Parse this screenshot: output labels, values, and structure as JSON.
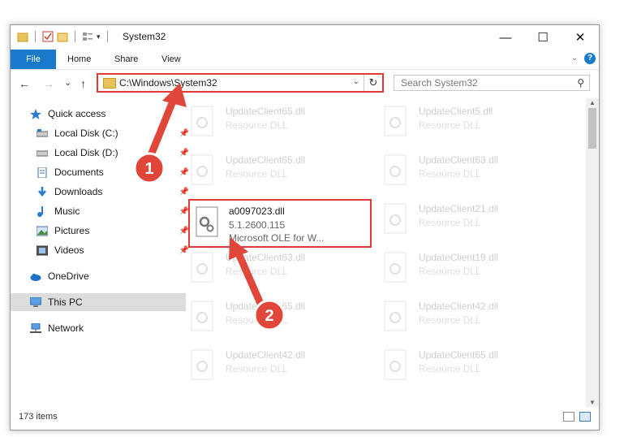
{
  "window": {
    "title": "System32",
    "controls": {
      "minimize": "—",
      "maximize": "☐",
      "close": "✕"
    }
  },
  "ribbon": {
    "tabs": [
      {
        "label": "File"
      },
      {
        "label": "Home"
      },
      {
        "label": "Share"
      },
      {
        "label": "View"
      }
    ]
  },
  "nav": {
    "back": "←",
    "forward": "→",
    "recent": "⌄",
    "up": "↑",
    "address": "C:\\Windows\\System32",
    "search_placeholder": "Search System32"
  },
  "sidebar": {
    "items": [
      {
        "label": "Quick access",
        "icon": "star-icon"
      },
      {
        "label": "Local Disk (C:)",
        "icon": "drive-icon"
      },
      {
        "label": "Local Disk (D:)",
        "icon": "drive-icon"
      },
      {
        "label": "Documents",
        "icon": "documents-icon"
      },
      {
        "label": "Downloads",
        "icon": "download-icon"
      },
      {
        "label": "Music",
        "icon": "music-icon"
      },
      {
        "label": "Pictures",
        "icon": "pictures-icon"
      },
      {
        "label": "Videos",
        "icon": "videos-icon"
      },
      {
        "label": "OneDrive",
        "icon": "cloud-icon"
      },
      {
        "label": "This PC",
        "icon": "computer-icon"
      },
      {
        "label": "Network",
        "icon": "network-icon"
      }
    ]
  },
  "files": {
    "left": [
      {
        "name": "UpdateClient65.dll",
        "desc": "Resource DLL"
      },
      {
        "name": "UpdateClient65.dll",
        "desc": "Resource DLL"
      },
      {
        "name": "a0097023.dll",
        "desc": "5.1.2600.115",
        "desc2": "Microsoft OLE for W..."
      },
      {
        "name": "UpdateClient63.dll",
        "desc": "Resource DLL"
      },
      {
        "name": "UpdateClient65.dll",
        "desc": "Resource DLL"
      },
      {
        "name": "UpdateClient42.dll",
        "desc": "Resource DLL"
      }
    ],
    "right": [
      {
        "name": "UpdateClient5.dll",
        "desc": "Resource DLL"
      },
      {
        "name": "UpdateClient63.dll",
        "desc": "Resource DLL"
      },
      {
        "name": "UpdateClient21.dll",
        "desc": "Resource DLL"
      },
      {
        "name": "UpdateClient19.dll",
        "desc": "Resource DLL"
      },
      {
        "name": "UpdateClient42.dll",
        "desc": "Resource DLL"
      },
      {
        "name": "UpdateClient65.dll",
        "desc": "Resource DLL"
      }
    ]
  },
  "status": {
    "count": "173 items"
  },
  "annotations": {
    "step1": "1",
    "step2": "2"
  },
  "colors": {
    "accent": "#1979ca",
    "highlight": "#e23b34"
  }
}
